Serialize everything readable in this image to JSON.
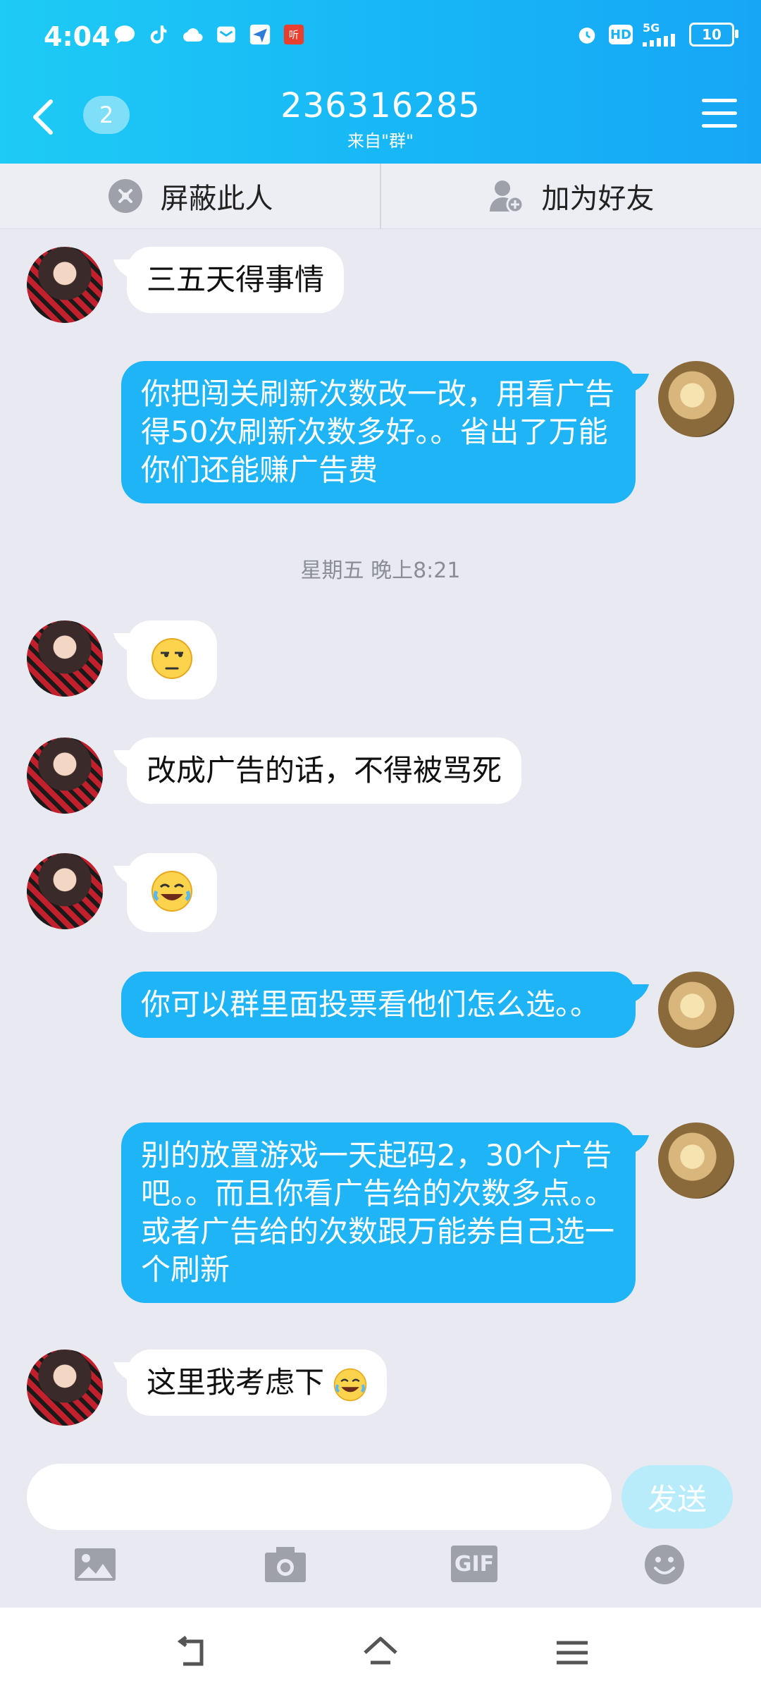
{
  "status_bar": {
    "time": "4:04",
    "network": "5G",
    "hd": "HD",
    "battery": "10"
  },
  "header": {
    "unread_count": "2",
    "title": "236316285",
    "subtitle": "来自\"群\""
  },
  "actions": {
    "block": "屏蔽此人",
    "add_friend": "加为好友"
  },
  "messages": [
    {
      "side": "left",
      "text": "三五天得事情"
    },
    {
      "side": "right",
      "text": "你把闯关刷新次数改一改，用看广告得50次刷新次数多好。。省出了万能你们还能赚广告费"
    },
    {
      "side": "left",
      "emoji": "smirk-emoji"
    },
    {
      "side": "left",
      "text": "改成广告的话，不得被骂死"
    },
    {
      "side": "left",
      "emoji": "laughing-tears-emoji"
    },
    {
      "side": "right",
      "text": "你可以群里面投票看他们怎么选。。"
    },
    {
      "side": "right",
      "text": "别的放置游戏一天起码2，30个广告吧。。而且你看广告给的次数多点。。或者广告给的次数跟万能券自己选一个刷新"
    },
    {
      "side": "left",
      "text": "这里我考虑下"
    }
  ],
  "timestamp": "星期五 晚上8:21",
  "input": {
    "send_label": "发送",
    "gif_label": "GIF"
  },
  "colors": {
    "accent": "#1fb4f6",
    "header_start": "#1ecbf5",
    "background": "#e9eaf1"
  }
}
